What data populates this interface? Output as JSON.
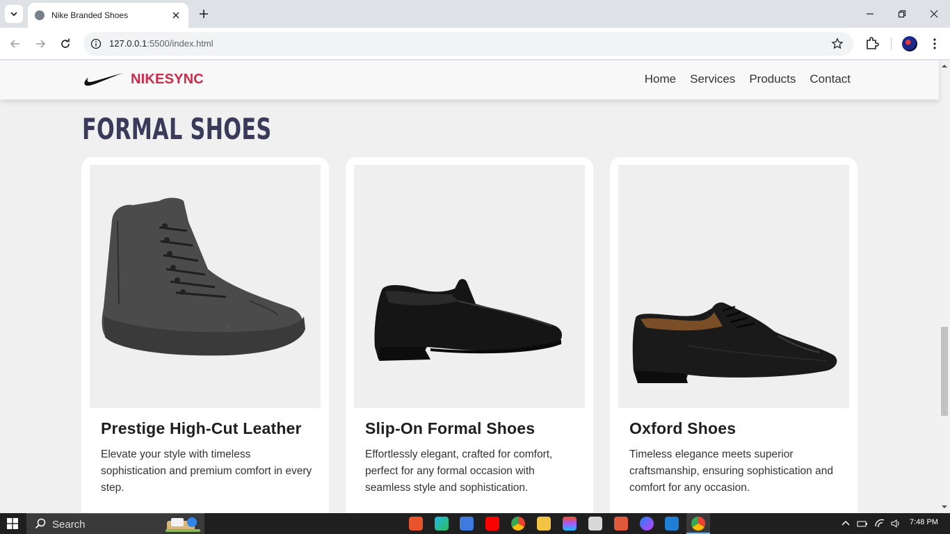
{
  "browser": {
    "tab_title": "Nike Branded Shoes",
    "url_host": "127.0.0.1",
    "url_path": ":5500/index.html"
  },
  "site": {
    "brand": "NIKESYNC",
    "nav": [
      "Home",
      "Services",
      "Products",
      "Contact"
    ],
    "section_title": "FORMAL SHOES",
    "products": [
      {
        "title": "Prestige High-Cut Leather",
        "description": "Elevate your style with timeless sophistication and premium comfort in every step.",
        "image_icon": "high-top-boot-image"
      },
      {
        "title": "Slip-On Formal Shoes",
        "description": "Effortlessly elegant, crafted for comfort, perfect for any formal occasion with seamless style and sophistication.",
        "image_icon": "loafer-image"
      },
      {
        "title": "Oxford Shoes",
        "description": "Timeless elegance meets superior craftsmanship, ensuring sophistication and comfort for any occasion.",
        "image_icon": "oxford-image"
      }
    ]
  },
  "taskbar": {
    "search_label": "Search",
    "time": "7:48 PM"
  },
  "colors": {
    "brand": "#cc2b4a",
    "section_title": "#3a3a5a",
    "page_bg": "#f0f0f0"
  }
}
